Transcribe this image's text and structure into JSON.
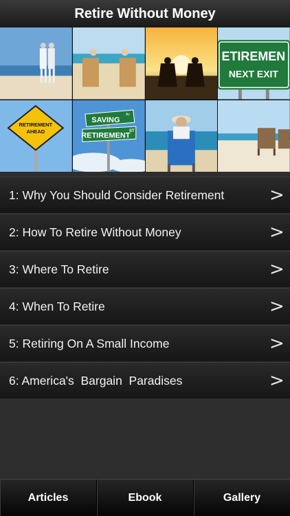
{
  "header": {
    "title": "Retire Without Money"
  },
  "banner": {
    "tiles": [
      {
        "name": "couple-beach-walk-photo"
      },
      {
        "name": "beach-chairs-couple-photo"
      },
      {
        "name": "sunset-chairs-photo"
      },
      {
        "name": "retirement-exit-sign-photo",
        "sign_line1": "ETIREMEN",
        "sign_line2": "NEXT EXIT"
      },
      {
        "name": "retirement-ahead-sign-photo",
        "sign_line1": "RETIREMENT",
        "sign_line2": "AHEAD"
      },
      {
        "name": "saving-retirement-street-sign-photo",
        "sign_line1": "SAVING",
        "sign_line1_sup": "Av",
        "sign_line2": "RETIREMENT",
        "sign_line2_sup": "ST"
      },
      {
        "name": "man-beach-chair-photo"
      },
      {
        "name": "empty-beach-chairs-photo"
      }
    ]
  },
  "menu": {
    "items": [
      {
        "label": "1: Why You Should Consider Retirement",
        "chevron": ">"
      },
      {
        "label": "2: How To Retire Without Money",
        "chevron": ">"
      },
      {
        "label": "3: Where To Retire",
        "chevron": ">"
      },
      {
        "label": "4: When To Retire",
        "chevron": ">"
      },
      {
        "label": "5: Retiring On A Small Income",
        "chevron": ">"
      },
      {
        "label": "6: America's  Bargain  Paradises",
        "chevron": ">"
      }
    ]
  },
  "tabbar": {
    "tabs": [
      {
        "label": "Articles"
      },
      {
        "label": "Ebook"
      },
      {
        "label": "Gallery"
      }
    ]
  }
}
